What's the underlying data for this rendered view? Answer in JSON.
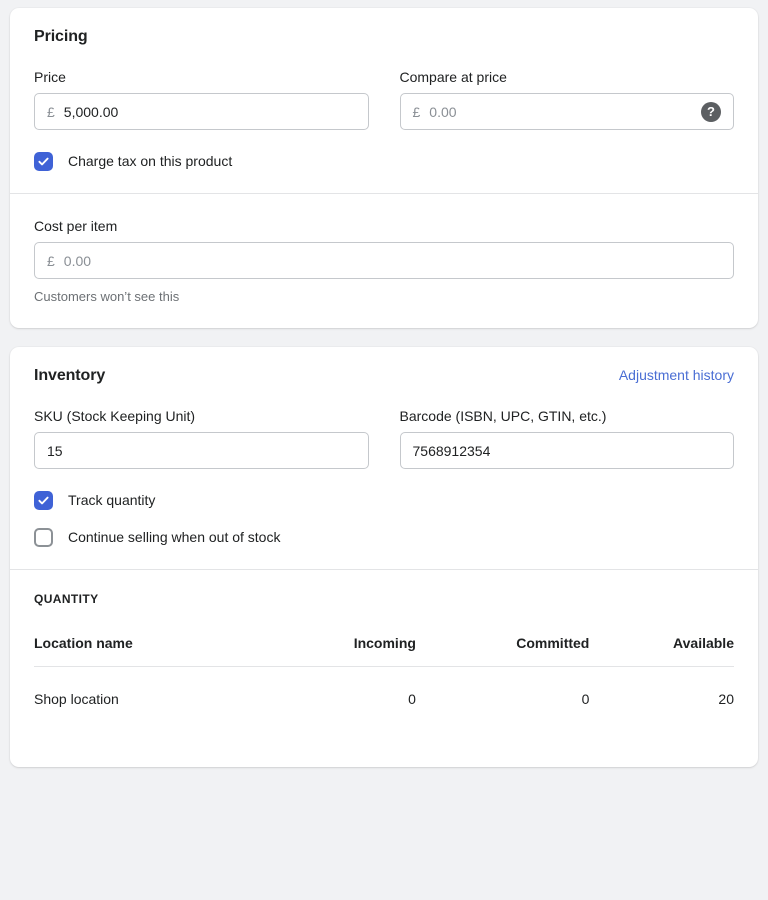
{
  "pricing": {
    "title": "Pricing",
    "price": {
      "label": "Price",
      "currency_symbol": "£",
      "value": "5,000.00"
    },
    "compare_at_price": {
      "label": "Compare at price",
      "currency_symbol": "£",
      "placeholder": "0.00",
      "help_icon": "help-circle-icon"
    },
    "charge_tax": {
      "label": "Charge tax on this product",
      "checked": true
    },
    "cost_per_item": {
      "label": "Cost per item",
      "currency_symbol": "£",
      "placeholder": "0.00",
      "help_text": "Customers won’t see this"
    }
  },
  "inventory": {
    "title": "Inventory",
    "adjustment_history_link": "Adjustment history",
    "sku": {
      "label": "SKU (Stock Keeping Unit)",
      "value": "15"
    },
    "barcode": {
      "label": "Barcode (ISBN, UPC, GTIN, etc.)",
      "value": "7568912354"
    },
    "track_quantity": {
      "label": "Track quantity",
      "checked": true
    },
    "continue_selling": {
      "label": "Continue selling when out of stock",
      "checked": false
    },
    "quantity": {
      "heading": "QUANTITY",
      "columns": [
        "Location name",
        "Incoming",
        "Committed",
        "Available"
      ],
      "rows": [
        {
          "location": "Shop location",
          "incoming": "0",
          "committed": "0",
          "available": "20"
        }
      ]
    }
  },
  "colors": {
    "accent_blue": "#4a6ed4",
    "checkbox_blue": "#3f62d6",
    "page_background": "#f1f2f4",
    "text": "#202223",
    "muted_text": "#6d7175"
  }
}
